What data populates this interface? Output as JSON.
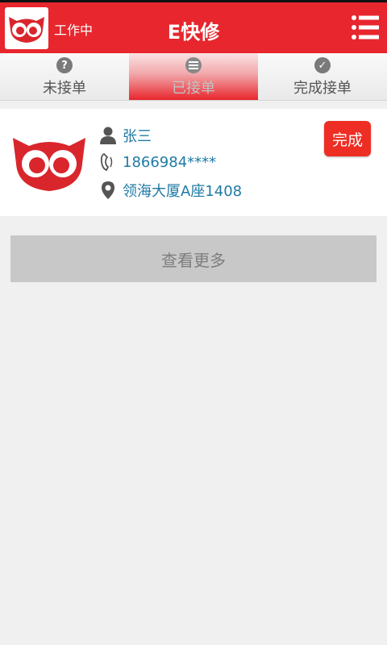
{
  "header": {
    "work_status": "工作中",
    "title": "E快修"
  },
  "tabs": [
    {
      "label": "未接单",
      "icon": "question-icon",
      "active": false
    },
    {
      "label": "已接单",
      "icon": "list-icon",
      "active": true
    },
    {
      "label": "完成接单",
      "icon": "check-icon",
      "active": false
    }
  ],
  "order": {
    "name": "张三",
    "phone": "1866984****",
    "address": "领海大厦A座1408",
    "complete_label": "完成"
  },
  "load_more_label": "查看更多",
  "colors": {
    "brand": "#e8262d",
    "link": "#1f7aa5",
    "button": "#ee2e24"
  }
}
